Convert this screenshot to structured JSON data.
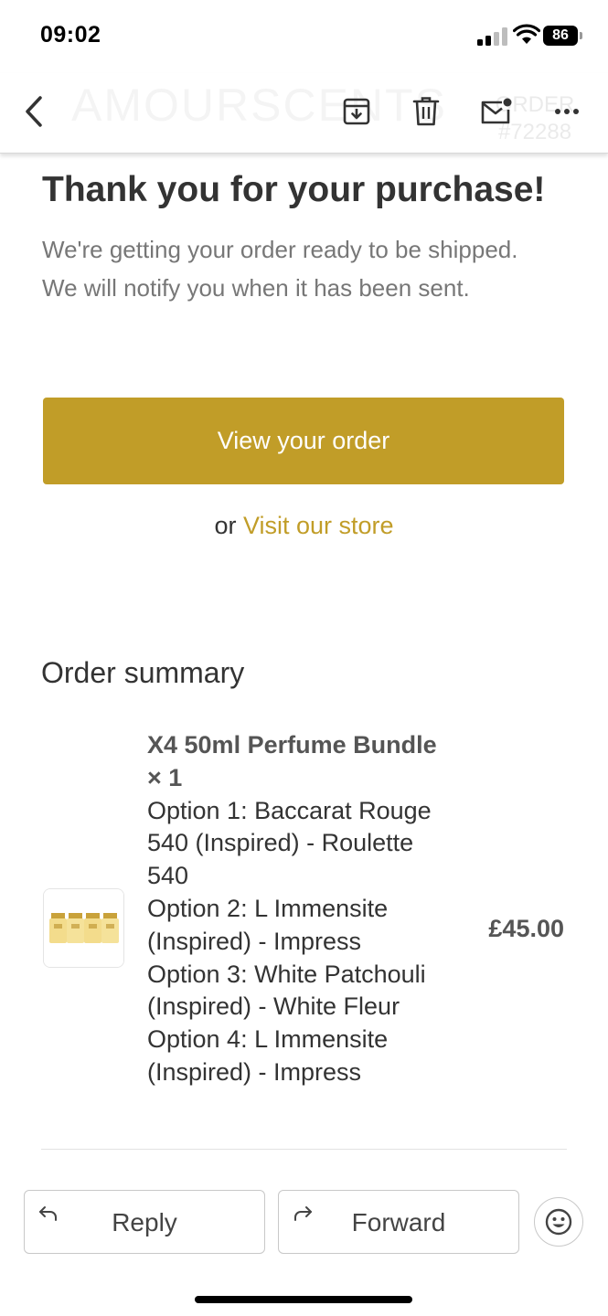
{
  "status_bar": {
    "time": "09:02",
    "battery": "86"
  },
  "toolbar": {
    "ghost_brand": "AMOURSCENTS",
    "ghost_order": "ORDER #72288",
    "icons": [
      "chevron-left-icon",
      "archive-icon",
      "trash-icon",
      "mark-unread-icon",
      "more-icon"
    ]
  },
  "email": {
    "headline": "Thank you for your purchase!",
    "subtext": "We're getting your order ready to be shipped. We will notify you when it has been sent.",
    "view_order_label": "View your order",
    "or_text": "or ",
    "visit_store_label": "Visit our store",
    "accent_color": "#c19d28"
  },
  "order_summary": {
    "title": "Order summary",
    "item": {
      "name": "X4 50ml Perfume Bundle × 1",
      "options": [
        "Option 1: Baccarat Rouge 540 (Inspired) - Roulette 540",
        "Option 2: L Immensite (Inspired) - Impress",
        "Option 3: White Patchouli (Inspired) - White Fleur",
        "Option 4: L Immensite (Inspired) - Impress"
      ],
      "price": "£45.00"
    }
  },
  "actions": {
    "reply_label": "Reply",
    "forward_label": "Forward"
  }
}
